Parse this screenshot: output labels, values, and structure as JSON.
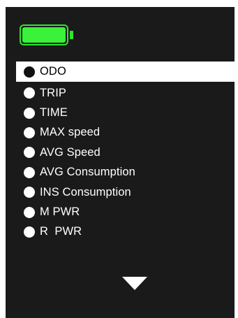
{
  "colors": {
    "screen_bg": "#1a1a1a",
    "battery": "#39f239",
    "selected_bg": "#ffffff",
    "text": "#ffffff"
  },
  "battery": {
    "level": 1.0,
    "icon": "battery-icon"
  },
  "menu": {
    "selected_index": 0,
    "items": [
      {
        "label": "ODO"
      },
      {
        "label": "TRIP"
      },
      {
        "label": "TIME"
      },
      {
        "label": "MAX speed"
      },
      {
        "label": "AVG Speed"
      },
      {
        "label": "AVG Consumption"
      },
      {
        "label": "INS Consumption"
      },
      {
        "label": "M PWR"
      },
      {
        "label": "R  PWR"
      }
    ]
  },
  "scroll": {
    "icon": "down-arrow-icon"
  }
}
